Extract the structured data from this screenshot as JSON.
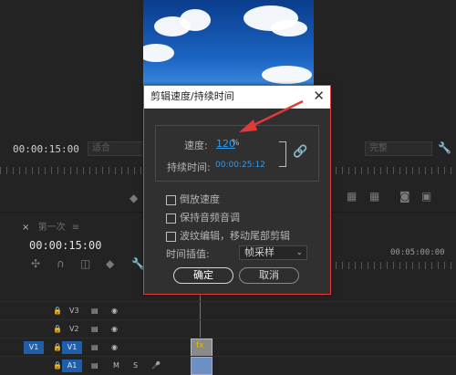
{
  "monitor": {
    "timecode_left": "00:00:15:00",
    "fit_select": "适合",
    "quality_select": "完整"
  },
  "timeline": {
    "tab_label": "第一次",
    "timecode": "00:00:15:00",
    "ruler_mark": "00:05:00:00",
    "tracks": [
      {
        "name": "V3",
        "source": ""
      },
      {
        "name": "V2",
        "source": ""
      },
      {
        "name": "V1",
        "source": "V1"
      },
      {
        "name": "A1",
        "source": "A1"
      }
    ],
    "clip_label": "fx"
  },
  "dialog": {
    "title": "剪辑速度/持续时间",
    "speed_label": "速度:",
    "speed_value": "120",
    "speed_unit": "%",
    "duration_label": "持续时间:",
    "duration_value": "00:00:25:12",
    "checkboxes": [
      {
        "label": "倒放速度",
        "checked": false
      },
      {
        "label": "保持音频音调",
        "checked": false
      },
      {
        "label": "波纹编辑，移动尾部剪辑",
        "checked": false
      }
    ],
    "interp_label": "时间插值:",
    "interp_value": "帧采样",
    "ok_label": "确定",
    "cancel_label": "取消"
  },
  "colors": {
    "accent_blue": "#2f9bf0",
    "annotation_red": "#e03a3a",
    "track_blue": "#1f5ea8"
  }
}
